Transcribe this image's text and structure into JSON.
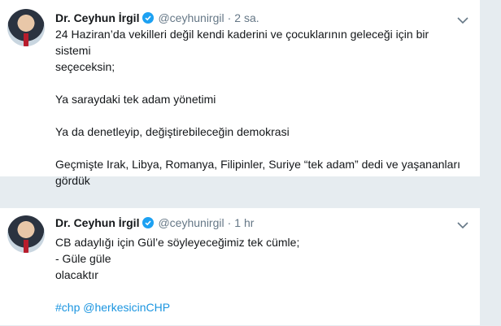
{
  "tweets": [
    {
      "author": "Dr. Ceyhun İrgil",
      "handle": "@ceyhunirgil",
      "separator": "·",
      "time": "2 sa.",
      "lines": [
        "24 Haziran’da vekilleri değil kendi kaderini ve çocuklarının geleceği için bir sistemi",
        "seçeceksin;",
        "Ya saraydaki tek adam yönetimi",
        "Ya da denetleyip, değiştirebileceğin demokrasi",
        "Geçmişte Irak, Libya, Romanya, Filipinler, Suriye “tek adam” dedi ve yaşananları",
        "gördük"
      ]
    },
    {
      "author": "Dr. Ceyhun İrgil",
      "handle": "@ceyhunirgil",
      "separator": "·",
      "time": "1 hr",
      "lines": [
        "CB adaylığı için Gül’e söyleyeceğimiz tek cümle;",
        "- Güle güle",
        "olacaktır"
      ],
      "hashtags": [
        "#chp",
        "@herkesicinCHP"
      ]
    }
  ],
  "colors": {
    "verified": "#1da1f2",
    "link": "#1b95e0",
    "muted": "#657786",
    "background": "#e6ecf0"
  },
  "icons": [
    "verified-badge-icon",
    "chevron-down-icon"
  ]
}
